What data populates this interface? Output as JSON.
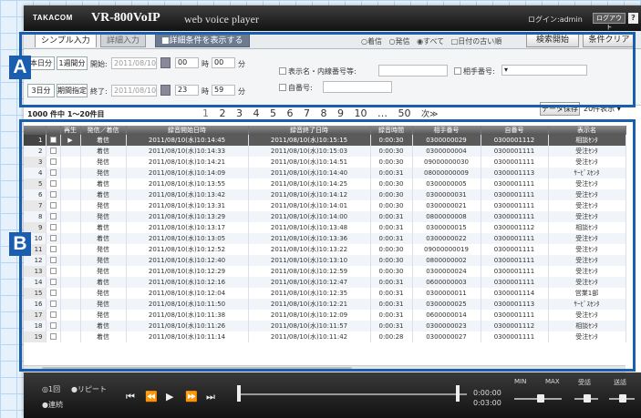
{
  "titlebar": {
    "logo": "TAKACOM",
    "title": "VR-800VoIP",
    "subtitle": "web voice player",
    "login": "ログイン:admin",
    "logout": "ログアウト",
    "help": "?"
  },
  "tabs": {
    "simple": "シンプル入力",
    "detail": "詳細入力",
    "toggle": "■詳細条件を表示する"
  },
  "search": {
    "radios": [
      "○着信",
      "○発信",
      "◉すべて",
      "□日付の古い順"
    ],
    "start": "検索開始",
    "clear": "条件クリア"
  },
  "filters": {
    "today": "本日分",
    "week": "1週間分",
    "three_days": "3日分",
    "period": "期間指定",
    "start_label": "開始:",
    "end_label": "終了:",
    "start_date": "2011/08/10",
    "end_date": "2011/08/10",
    "start_hour": "00",
    "hour_unit": "時",
    "start_min": "00",
    "min_unit": "分",
    "end_hour": "23",
    "end_min": "59",
    "display_name": "表示名・内線番号等:",
    "extension": "自番号:",
    "partner": "相手番号:"
  },
  "results": {
    "count": "1000 件中 1〜20件目",
    "pages": [
      "1",
      "2",
      "3",
      "4",
      "5",
      "6",
      "7",
      "8",
      "9",
      "10",
      "…",
      "50",
      "次≫"
    ],
    "save": "データ保存",
    "per_page": "20件表示  ▾"
  },
  "table": {
    "headers": [
      "",
      "",
      "再生",
      "発信／着信",
      "録音開始日時",
      "録音終了日時",
      "録音時間",
      "相手番号",
      "自番号",
      "表示名"
    ],
    "rows": [
      {
        "n": "1",
        "play": "▶",
        "dir": "着信",
        "start": "2011/08/10(水)10:14:45",
        "end": "2011/08/10(水)10:15:15",
        "dur": "0:00:30",
        "partner": "0300000029",
        "own": "0300001112",
        "name": "相談ｾﾝﾀ"
      },
      {
        "n": "2",
        "play": "",
        "dir": "着信",
        "start": "2011/08/10(水)10:14:33",
        "end": "2011/08/10(水)10:15:03",
        "dur": "0:00:30",
        "partner": "0300000004",
        "own": "0300001111",
        "name": "受注ｾﾝﾀ"
      },
      {
        "n": "3",
        "play": "",
        "dir": "発信",
        "start": "2011/08/10(水)10:14:21",
        "end": "2011/08/10(水)10:14:51",
        "dur": "0:00:30",
        "partner": "09000000030",
        "own": "0300001111",
        "name": "受注ｾﾝﾀ"
      },
      {
        "n": "4",
        "play": "",
        "dir": "発信",
        "start": "2011/08/10(水)10:14:09",
        "end": "2011/08/10(水)10:14:40",
        "dur": "0:00:31",
        "partner": "08000000009",
        "own": "0300001113",
        "name": "ｻｰﾋﾞｽｾﾝﾀ"
      },
      {
        "n": "5",
        "play": "",
        "dir": "着信",
        "start": "2011/08/10(水)10:13:55",
        "end": "2011/08/10(水)10:14:25",
        "dur": "0:00:30",
        "partner": "0300000005",
        "own": "0300001111",
        "name": "受注ｾﾝﾀ"
      },
      {
        "n": "6",
        "play": "",
        "dir": "着信",
        "start": "2011/08/10(水)10:13:42",
        "end": "2011/08/10(水)10:14:12",
        "dur": "0:00:30",
        "partner": "0300000031",
        "own": "0300001111",
        "name": "受注ｾﾝﾀ"
      },
      {
        "n": "7",
        "play": "",
        "dir": "発信",
        "start": "2011/08/10(水)10:13:31",
        "end": "2011/08/10(水)10:14:01",
        "dur": "0:00:30",
        "partner": "0300000021",
        "own": "0300001111",
        "name": "受注ｾﾝﾀ"
      },
      {
        "n": "8",
        "play": "",
        "dir": "発信",
        "start": "2011/08/10(水)10:13:29",
        "end": "2011/08/10(水)10:14:00",
        "dur": "0:00:31",
        "partner": "0800000008",
        "own": "0300001111",
        "name": "受注ｾﾝﾀ"
      },
      {
        "n": "9",
        "play": "",
        "dir": "着信",
        "start": "2011/08/10(水)10:13:17",
        "end": "2011/08/10(水)10:13:48",
        "dur": "0:00:31",
        "partner": "0300000015",
        "own": "0300001112",
        "name": "相談ｾﾝﾀ"
      },
      {
        "n": "10",
        "play": "",
        "dir": "着信",
        "start": "2011/08/10(水)10:13:05",
        "end": "2011/08/10(水)10:13:36",
        "dur": "0:00:31",
        "partner": "0300000022",
        "own": "0300001111",
        "name": "受注ｾﾝﾀ"
      },
      {
        "n": "11",
        "play": "",
        "dir": "発信",
        "start": "2011/08/10(水)10:12:52",
        "end": "2011/08/10(水)10:13:22",
        "dur": "0:00:30",
        "partner": "09000000019",
        "own": "0300001111",
        "name": "受注ｾﾝﾀ"
      },
      {
        "n": "12",
        "play": "",
        "dir": "発信",
        "start": "2011/08/10(水)10:12:40",
        "end": "2011/08/10(水)10:13:10",
        "dur": "0:00:30",
        "partner": "0800000002",
        "own": "0300001111",
        "name": "受注ｾﾝﾀ"
      },
      {
        "n": "13",
        "play": "",
        "dir": "発信",
        "start": "2011/08/10(水)10:12:29",
        "end": "2011/08/10(水)10:12:59",
        "dur": "0:00:30",
        "partner": "0300000024",
        "own": "0300001111",
        "name": "受注ｾﾝﾀ"
      },
      {
        "n": "14",
        "play": "",
        "dir": "着信",
        "start": "2011/08/10(水)10:12:16",
        "end": "2011/08/10(水)10:12:47",
        "dur": "0:00:31",
        "partner": "0600000003",
        "own": "0300001111",
        "name": "受注ｾﾝﾀ"
      },
      {
        "n": "15",
        "play": "",
        "dir": "発信",
        "start": "2011/08/10(水)10:12:04",
        "end": "2011/08/10(水)10:12:35",
        "dur": "0:00:31",
        "partner": "0300000011",
        "own": "0300001114",
        "name": "営業1部"
      },
      {
        "n": "16",
        "play": "",
        "dir": "発信",
        "start": "2011/08/10(水)10:11:50",
        "end": "2011/08/10(水)10:12:21",
        "dur": "0:00:31",
        "partner": "0300000025",
        "own": "0300001113",
        "name": "ｻｰﾋﾞｽｾﾝﾀ"
      },
      {
        "n": "17",
        "play": "",
        "dir": "発信",
        "start": "2011/08/10(水)10:11:38",
        "end": "2011/08/10(水)10:12:09",
        "dur": "0:00:31",
        "partner": "0600000014",
        "own": "0300001111",
        "name": "受注ｾﾝﾀ"
      },
      {
        "n": "18",
        "play": "",
        "dir": "着信",
        "start": "2011/08/10(水)10:11:26",
        "end": "2011/08/10(水)10:11:57",
        "dur": "0:00:31",
        "partner": "0300000023",
        "own": "0300001112",
        "name": "相談ｾﾝﾀ"
      },
      {
        "n": "19",
        "play": "",
        "dir": "着信",
        "start": "2011/08/10(水)10:11:14",
        "end": "2011/08/10(水)10:11:42",
        "dur": "0:00:28",
        "partner": "0300000027",
        "own": "0300001111",
        "name": "受注ｾﾝﾀ"
      }
    ]
  },
  "player": {
    "mode_once": "◎1回",
    "mode_repeat": "●リピート",
    "mode_cont": "●連続",
    "time_elapsed": "0:00:00",
    "time_total": "0:03:00",
    "vol_min": "MIN",
    "vol_max": "MAX",
    "lbl_rx": "受話",
    "lbl_tx": "送話",
    "progress": 0,
    "volume": 0.55,
    "rx": 0.55,
    "tx": 0.55
  },
  "callouts": {
    "a": "A",
    "b": "B"
  }
}
